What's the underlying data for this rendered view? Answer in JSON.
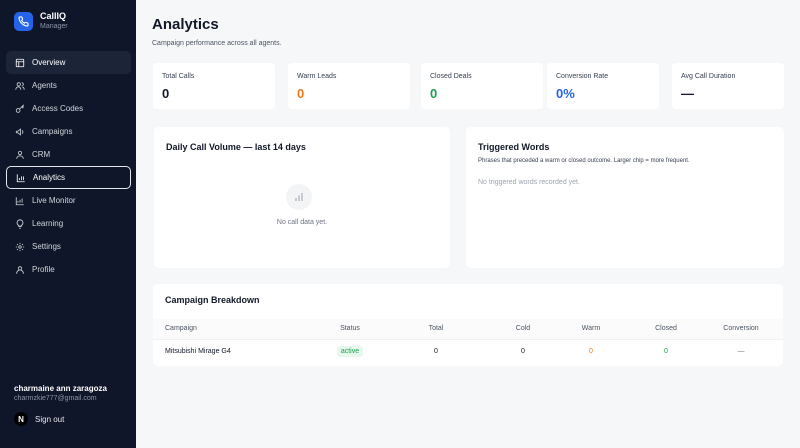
{
  "app": {
    "name": "CallIQ",
    "role": "Manager"
  },
  "sidebar": {
    "items": [
      {
        "label": "Overview",
        "icon": "layout-icon"
      },
      {
        "label": "Agents",
        "icon": "users-icon"
      },
      {
        "label": "Access Codes",
        "icon": "key-icon"
      },
      {
        "label": "Campaigns",
        "icon": "megaphone-icon"
      },
      {
        "label": "CRM",
        "icon": "crm-icon"
      },
      {
        "label": "Analytics",
        "icon": "bar-chart-icon"
      },
      {
        "label": "Live Monitor",
        "icon": "monitor-icon"
      },
      {
        "label": "Learning",
        "icon": "lightbulb-icon"
      },
      {
        "label": "Settings",
        "icon": "gear-icon"
      },
      {
        "label": "Profile",
        "icon": "user-icon"
      }
    ]
  },
  "user": {
    "name": "charmaine ann zaragoza",
    "email": "charmzkie777@gmail.com",
    "signout": "Sign out",
    "badge": "N"
  },
  "page": {
    "title": "Analytics",
    "subtitle": "Campaign performance across all agents."
  },
  "stats": [
    {
      "label": "Total Calls",
      "value": "0",
      "color": "#111827"
    },
    {
      "label": "Warm Leads",
      "value": "0",
      "color": "#ea7a1a"
    },
    {
      "label": "Closed Deals",
      "value": "0",
      "color": "#16a34a"
    },
    {
      "label": "Conversion Rate",
      "value": "0%",
      "color": "#2563eb"
    },
    {
      "label": "Avg Call Duration",
      "value": "—",
      "color": "#111827"
    }
  ],
  "daily": {
    "title": "Daily Call Volume — last 14 days",
    "empty": "No call data yet."
  },
  "triggered": {
    "title": "Triggered Words",
    "desc": "Phrases that preceded a warm or closed outcome. Larger chip = more frequent.",
    "empty": "No triggered words recorded yet."
  },
  "breakdown": {
    "title": "Campaign Breakdown",
    "headers": [
      "Campaign",
      "Status",
      "Total",
      "Cold",
      "Warm",
      "Closed",
      "Conversion"
    ],
    "rows": [
      {
        "campaign": "Mitsubishi Mirage G4",
        "status": "active",
        "total": "0",
        "cold": "0",
        "warm": "0",
        "closed": "0",
        "conversion": "—"
      }
    ]
  }
}
